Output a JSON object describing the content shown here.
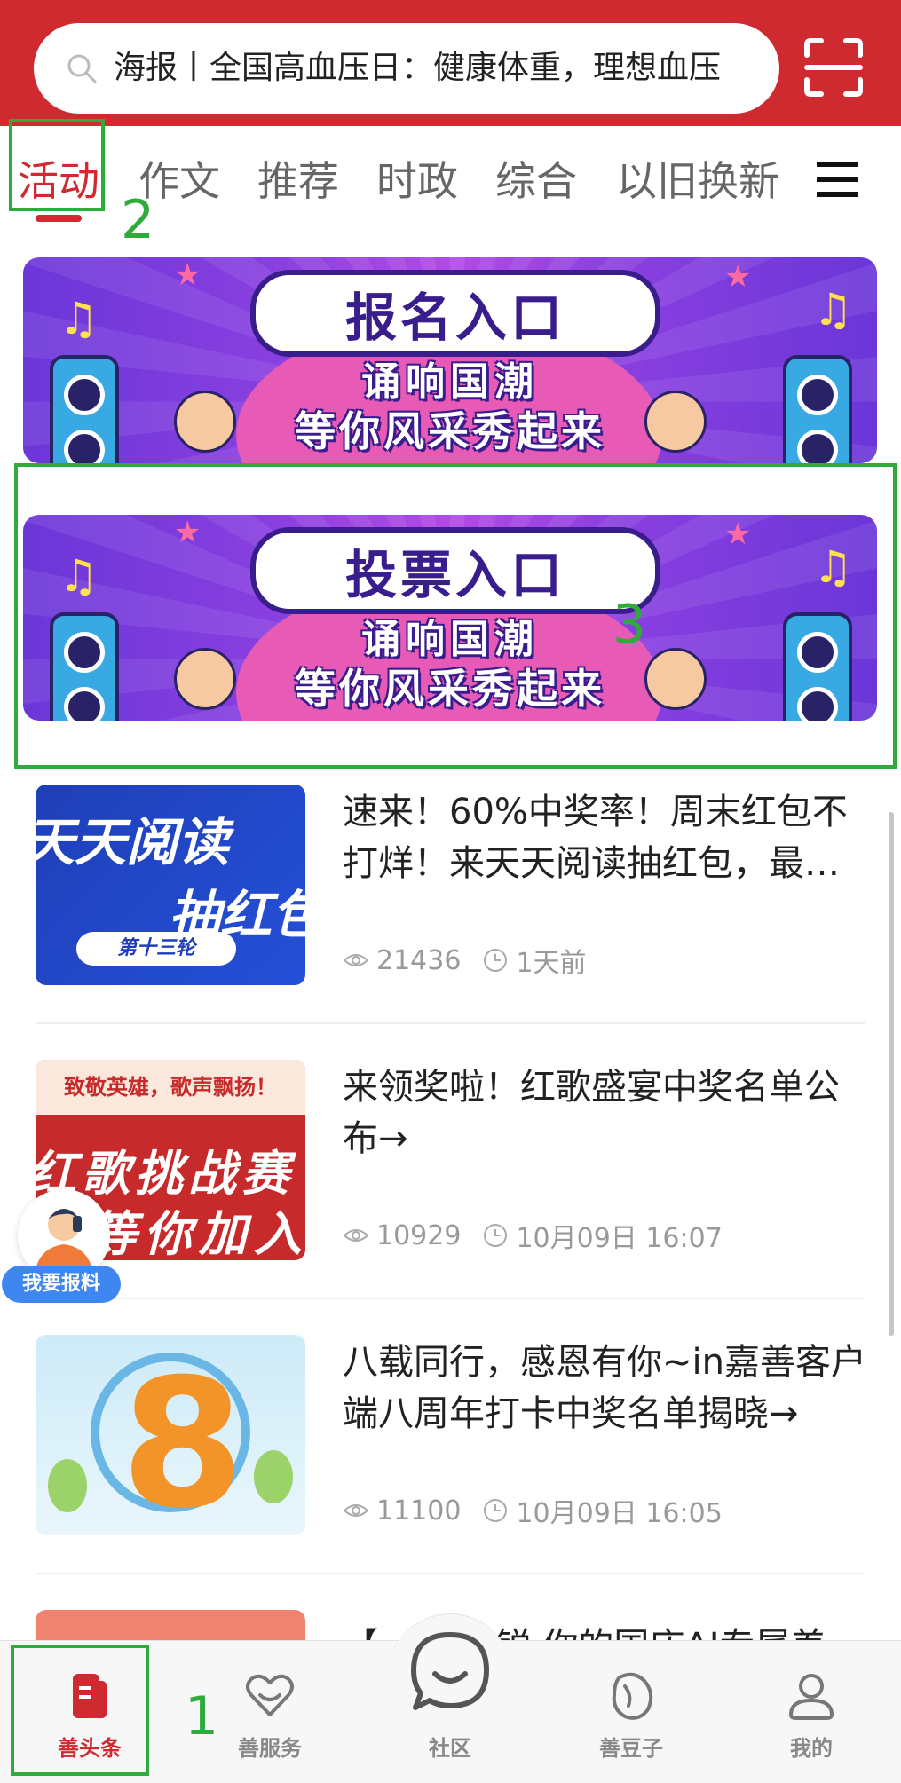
{
  "search": {
    "placeholder_text": "海报丨全国高血压日：健康体重，理想血压"
  },
  "tabs": [
    {
      "label": "活动",
      "active": true
    },
    {
      "label": "作文"
    },
    {
      "label": "推荐"
    },
    {
      "label": "时政"
    },
    {
      "label": "综合"
    },
    {
      "label": "以旧换新"
    }
  ],
  "banners": [
    {
      "title": "报名入口",
      "line1": "诵响国潮",
      "line2": "等你风采秀起来"
    },
    {
      "title": "投票入口",
      "line1": "诵响国潮",
      "line2": "等你风采秀起来"
    }
  ],
  "articles": [
    {
      "title": "速来！60%中奖率！周末红包不打烊！来天天阅读抽红包，最…",
      "views": "21436",
      "time": "1天前",
      "thumb": {
        "line1": "天天阅读",
        "line2": "抽红包",
        "badge": "第十三轮"
      }
    },
    {
      "title": "来领奖啦！红歌盛宴中奖名单公布→",
      "views": "10929",
      "time": "10月09日 16:07",
      "thumb": {
        "top": "致敬英雄，歌声飘扬！",
        "mid": "红歌挑战赛",
        "bot": "等你加入"
      }
    },
    {
      "title": "八载同行，感恩有你~in嘉善客户端八周年打卡中奖名单揭晓→",
      "views": "11100",
      "time": "10月09日 16:05",
      "thumb": {
        "number": "8"
      }
    }
  ],
  "peek_article": {
    "title": "【 　　　锐 你的国庆AI专属差"
  },
  "report_button": {
    "label": "我要报料"
  },
  "bottom_nav": [
    {
      "label": "善头条",
      "active": true
    },
    {
      "label": "善服务"
    },
    {
      "label": "社区"
    },
    {
      "label": "善豆子"
    },
    {
      "label": "我的"
    }
  ],
  "annotations": [
    "1",
    "2",
    "3"
  ],
  "colors": {
    "brand_red": "#cf2a2f",
    "annotation_green": "#2eab3a",
    "report_blue": "#3f87f0"
  }
}
